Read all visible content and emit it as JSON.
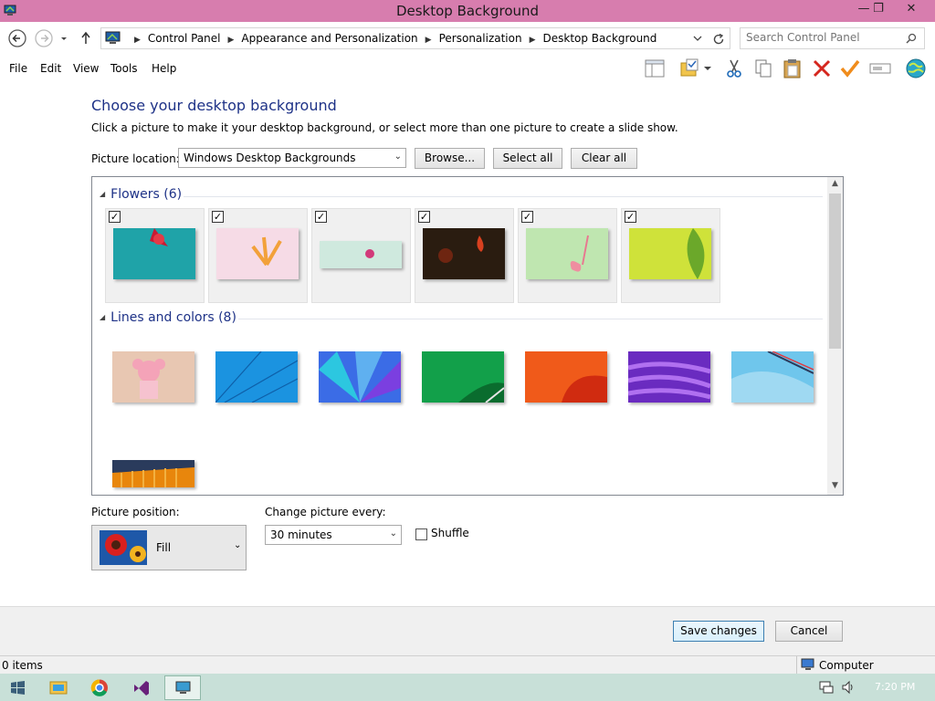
{
  "window": {
    "title": "Desktop Background",
    "minimize": "—",
    "restore": "❐",
    "close": "✕"
  },
  "address": {
    "crumbs": [
      "Control Panel",
      "Appearance and Personalization",
      "Personalization",
      "Desktop Background"
    ],
    "search_placeholder": "Search Control Panel"
  },
  "menu": [
    "File",
    "Edit",
    "View",
    "Tools",
    "Help"
  ],
  "main": {
    "heading": "Choose your desktop background",
    "description": "Click a picture to make it your desktop background, or select more than one picture to create a slide show.",
    "location_label": "Picture location:",
    "location_value": "Windows Desktop Backgrounds",
    "browse": "Browse...",
    "select_all": "Select all",
    "clear_all": "Clear all"
  },
  "groups": [
    {
      "label": "Flowers (6)",
      "items": [
        {
          "checked": true,
          "colors": [
            "#1fa3a8",
            "#c81a33"
          ]
        },
        {
          "checked": true,
          "colors": [
            "#f6dbe6",
            "#f2a13a"
          ]
        },
        {
          "checked": true,
          "colors": [
            "#cfe9de",
            "#d23a7a"
          ]
        },
        {
          "checked": true,
          "colors": [
            "#2a1c10",
            "#d8401f"
          ]
        },
        {
          "checked": true,
          "colors": [
            "#bfe6b0",
            "#ef8ea0"
          ]
        },
        {
          "checked": true,
          "colors": [
            "#cfe23a",
            "#6ba82a"
          ]
        }
      ]
    },
    {
      "label": "Lines and colors (8)",
      "items": [
        {
          "colors": [
            "#e8c7b2",
            "#f4a3b8"
          ]
        },
        {
          "colors": [
            "#1b93e0",
            "#0e5fa8"
          ]
        },
        {
          "colors": [
            "#3b6ce6",
            "#2cc7e0"
          ]
        },
        {
          "colors": [
            "#12a04a",
            "#0a6c2e"
          ]
        },
        {
          "colors": [
            "#f05a1a",
            "#d02b10"
          ]
        },
        {
          "colors": [
            "#6a2bc0",
            "#b070f0"
          ]
        },
        {
          "colors": [
            "#6fc6ec",
            "#9fd9f2"
          ]
        },
        {
          "colors": [
            "#e8860c",
            "#2a3b5c"
          ]
        }
      ]
    }
  ],
  "options": {
    "position_label": "Picture position:",
    "position_value": "Fill",
    "change_label": "Change picture every:",
    "change_value": "30 minutes",
    "shuffle_label": "Shuffle",
    "shuffle_checked": false
  },
  "footer": {
    "save": "Save changes",
    "cancel": "Cancel"
  },
  "status": {
    "items": "0 items",
    "location": "Computer"
  },
  "taskbar": {
    "time": "7:20 PM"
  }
}
